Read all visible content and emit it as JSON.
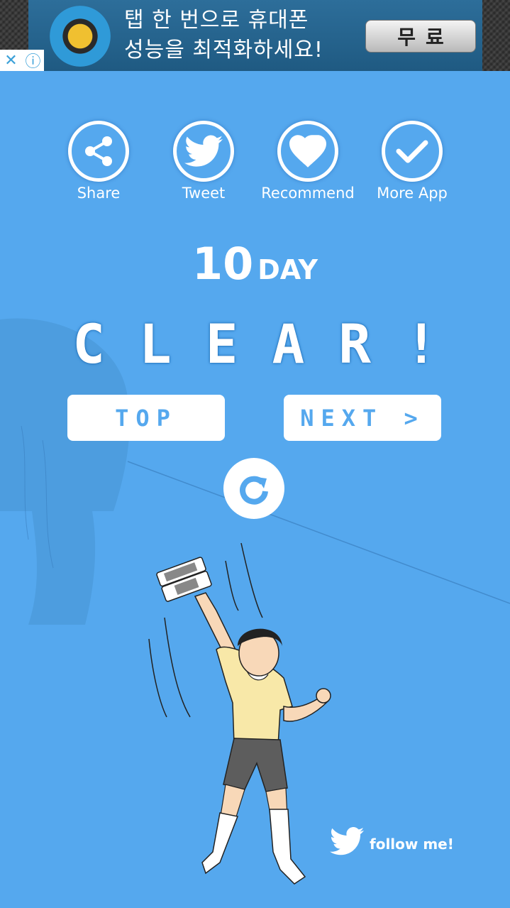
{
  "ad": {
    "line1": "탭 한 번으로 휴대폰",
    "line2": "성능을 최적화하세요!",
    "cta": "무료",
    "close": "✕",
    "info": "ⓘ"
  },
  "share": [
    {
      "label": "Share",
      "icon": "share-icon"
    },
    {
      "label": "Tweet",
      "icon": "twitter-icon"
    },
    {
      "label": "Recommend",
      "icon": "heart-icon"
    },
    {
      "label": "More App",
      "icon": "check-icon"
    }
  ],
  "result": {
    "day_number": "10",
    "day_unit": "DAY",
    "clear_text": "CLEAR!"
  },
  "buttons": {
    "top": "TOP",
    "next": "NEXT >"
  },
  "footer": {
    "follow": "follow me!"
  },
  "colors": {
    "background": "#55a8ee",
    "accent": "#ffffff"
  }
}
